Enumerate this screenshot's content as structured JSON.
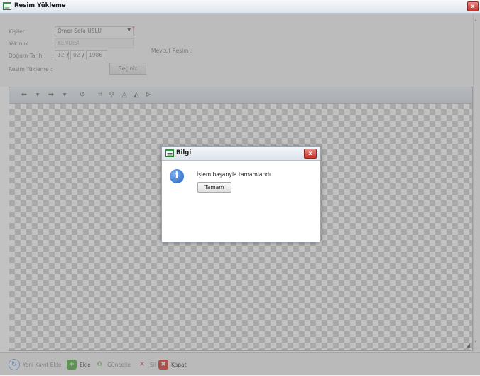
{
  "window": {
    "title": "Resim Yükleme",
    "close_label": "x"
  },
  "form": {
    "kisiler_label": "Kişiler",
    "kisiler_value": "Ömer Sefa USLU",
    "required_mark": "*",
    "yakinlik_label": "Yakınlık",
    "yakinlik_value": "KENDİSİ",
    "dogum_label": "Doğum Tarihi",
    "sep": ":",
    "dogum_day": "12",
    "dogum_month": "02",
    "dogum_year": "1986",
    "date_sep": "/",
    "mevcut_label": "Mevcut Resim :",
    "yukleme_label": "Resim Yükleme :",
    "seciniz_label": "Seçiniz"
  },
  "toolbar_icons": [
    "undo-arrow-icon",
    "dropdown-icon",
    "redo-arrow-icon",
    "dropdown-icon",
    "rotate-icon",
    "crop-icon",
    "zoom-icon",
    "brightness-icon",
    "contrast-icon",
    "flip-icon"
  ],
  "dialog": {
    "title": "Bilgi",
    "close_label": "x",
    "message": "İşlem başarıyla tamamlandı",
    "ok_label": "Tamam",
    "info_glyph": "i"
  },
  "bottombar": {
    "yeni_label": "Yeni Kayıt Ekle",
    "ekle_label": "Ekle",
    "guncelle_label": "Güncelle",
    "sil_label": "Sil",
    "kapat_label": "Kapat"
  },
  "colors": {
    "dialog_close": "#c2322a",
    "add_green": "#3a9a2a",
    "delete_red": "#d03a2a"
  }
}
